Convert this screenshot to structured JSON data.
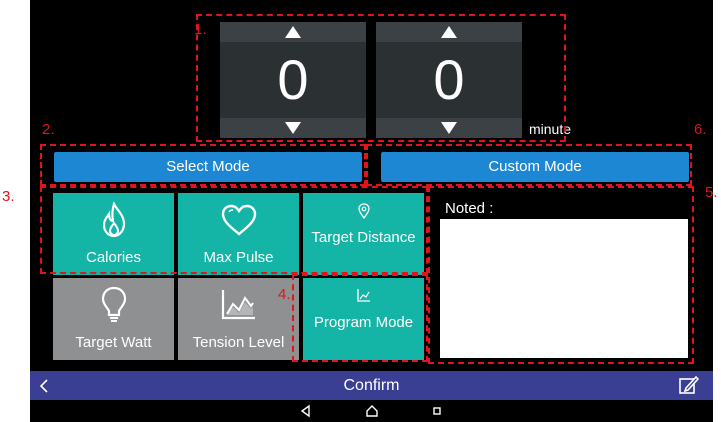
{
  "timer": {
    "first_value": "0",
    "second_value": "0",
    "unit": "minute",
    "up_icon": "triangle-up-icon",
    "down_icon": "triangle-down-icon"
  },
  "modes": {
    "select_label": "Select Mode",
    "custom_label": "Custom Mode"
  },
  "tiles": [
    {
      "label": "Calories",
      "icon": "flame-icon",
      "state": "active"
    },
    {
      "label": "Max Pulse",
      "icon": "heart-icon",
      "state": "active"
    },
    {
      "label": "Target Distance",
      "icon": "location-pin-icon",
      "state": "active"
    },
    {
      "label": "Target Watt",
      "icon": "lightbulb-icon",
      "state": "inactive"
    },
    {
      "label": "Tension Level",
      "icon": "area-chart-icon",
      "state": "inactive"
    },
    {
      "label": "Program Mode",
      "icon": "chart-icon",
      "state": "active"
    }
  ],
  "notes": {
    "title": "Noted :",
    "value": ""
  },
  "footer": {
    "back_icon": "chevron-left-icon",
    "confirm_label": "Confirm",
    "edit_icon": "edit-icon"
  },
  "navigation": {
    "back_icon": "nav-back-icon",
    "home_icon": "nav-home-icon",
    "recents_icon": "nav-recents-icon"
  },
  "annotations": {
    "one": "1.",
    "two": "2.",
    "three": "3.",
    "four": "4.",
    "five": "5.",
    "six": "6."
  },
  "colors": {
    "mode_button": "#1e87d4",
    "tile_active": "#14b5a7",
    "tile_inactive": "#8e9091",
    "confirm_bar": "#3a3f94",
    "annotation": "#e0141b"
  }
}
